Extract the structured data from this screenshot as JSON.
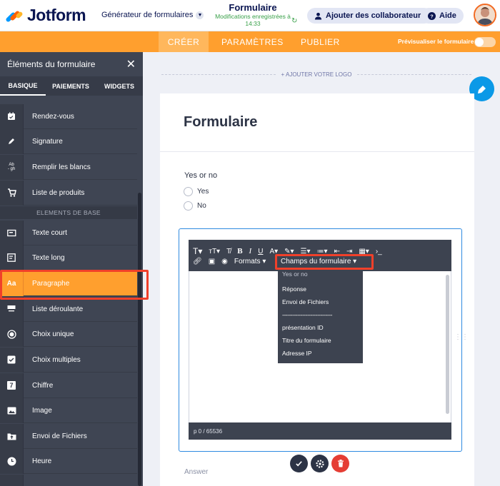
{
  "app": {
    "logo_text": "Jotform",
    "generator_label": "Générateur de formulaires",
    "form_title": "Formulaire",
    "save_status": "Modifications enregistrées à 14:33",
    "collab_button": "Ajouter des collaborateurs",
    "help_button": "Aide"
  },
  "nav": {
    "tabs": [
      {
        "label": "CRÉER"
      },
      {
        "label": "PARAMÈTRES"
      },
      {
        "label": "PUBLIER"
      }
    ],
    "preview_label": "Prévisualiser le formulaire"
  },
  "sidebar": {
    "title": "Éléments du formulaire",
    "tabs": [
      {
        "label": "BASIQUE"
      },
      {
        "label": "PAIEMENTS"
      },
      {
        "label": "WIDGETS"
      }
    ],
    "items_top": [
      {
        "label": "Rendez-vous",
        "icon": "calendar-icon"
      },
      {
        "label": "Signature",
        "icon": "pen-icon"
      },
      {
        "label": "Remplir les blancs",
        "icon": "fill-blanks-icon"
      },
      {
        "label": "Liste de produits",
        "icon": "cart-icon"
      }
    ],
    "section_label": "ELEMENTS DE BASE",
    "items_basic": [
      {
        "label": "Texte court",
        "icon": "short-text-icon"
      },
      {
        "label": "Texte long",
        "icon": "long-text-icon"
      },
      {
        "label": "Paragraphe",
        "icon": "paragraph-icon",
        "icon_text": "Aa"
      },
      {
        "label": "Liste déroulante",
        "icon": "dropdown-icon"
      },
      {
        "label": "Choix unique",
        "icon": "radio-icon"
      },
      {
        "label": "Choix multiples",
        "icon": "checkbox-icon"
      },
      {
        "label": "Chiffre",
        "icon": "number-icon",
        "icon_text": "7"
      },
      {
        "label": "Image",
        "icon": "image-icon"
      },
      {
        "label": "Envoi de Fichiers",
        "icon": "file-upload-icon"
      },
      {
        "label": "Heure",
        "icon": "clock-icon"
      }
    ]
  },
  "canvas": {
    "add_logo": "+ AJOUTER VOTRE LOGO",
    "form_heading": "Formulaire",
    "question": {
      "label": "Yes or no",
      "options": [
        "Yes",
        "No"
      ]
    },
    "editor": {
      "formats_label": "Formats",
      "form_fields_label": "Champs du formulaire",
      "status": "p   0 / 65536",
      "menu_items": [
        "Yes or no",
        "Réponse",
        "Envoi de Fichiers",
        "------------------------------",
        "présentation ID",
        "Titre du formulaire",
        "Adresse IP"
      ]
    },
    "answer_label": "Answer"
  },
  "colors": {
    "accent_orange": "#ff9f2e",
    "brand_navy": "#0a1551",
    "sidebar_bg": "#3f4553",
    "highlight_red": "#f0402a",
    "paint_blue": "#0b99e7"
  }
}
